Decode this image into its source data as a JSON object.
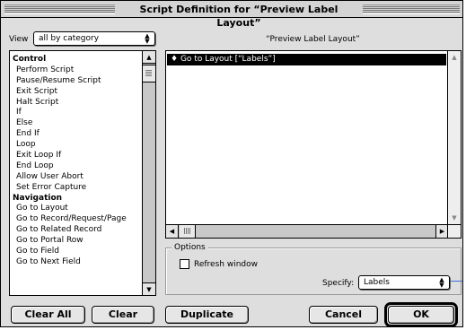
{
  "window": {
    "title": "Script Definition for “Preview Label Layout”"
  },
  "view": {
    "label": "View",
    "selected": "all by category"
  },
  "commands": {
    "items": [
      {
        "label": "Control",
        "category": true
      },
      {
        "label": "Perform Script"
      },
      {
        "label": "Pause/Resume Script"
      },
      {
        "label": "Exit Script"
      },
      {
        "label": "Halt Script"
      },
      {
        "label": "If"
      },
      {
        "label": "Else"
      },
      {
        "label": "End If"
      },
      {
        "label": "Loop"
      },
      {
        "label": "Exit Loop If"
      },
      {
        "label": "End Loop"
      },
      {
        "label": "Allow User Abort"
      },
      {
        "label": "Set Error Capture"
      },
      {
        "label": "Navigation",
        "category": true
      },
      {
        "label": "Go to Layout"
      },
      {
        "label": "Go to Record/Request/Page"
      },
      {
        "label": "Go to Related Record"
      },
      {
        "label": "Go to Portal Row"
      },
      {
        "label": "Go to Field"
      },
      {
        "label": "Go to Next Field"
      }
    ]
  },
  "script": {
    "name": "“Preview Label Layout”",
    "steps": [
      {
        "marker": "♦",
        "text": "Go to Layout [“Labels”]",
        "selected": true
      }
    ]
  },
  "options": {
    "label": "Options",
    "refresh_label": "Refresh window",
    "refresh_checked": false,
    "specify_label": "Specify:",
    "specify_value": "Labels"
  },
  "buttons": {
    "clear_all": "Clear All",
    "clear": "Clear",
    "duplicate": "Duplicate",
    "cancel": "Cancel",
    "ok": "OK"
  },
  "icons": {
    "up_arrow": "▲",
    "down_arrow": "▼",
    "left_arrow": "◀",
    "right_arrow": "▶",
    "popup_arrows": "▲▼"
  },
  "colors": {
    "connector": "#3b6ed6",
    "selection_bg": "#000000"
  }
}
